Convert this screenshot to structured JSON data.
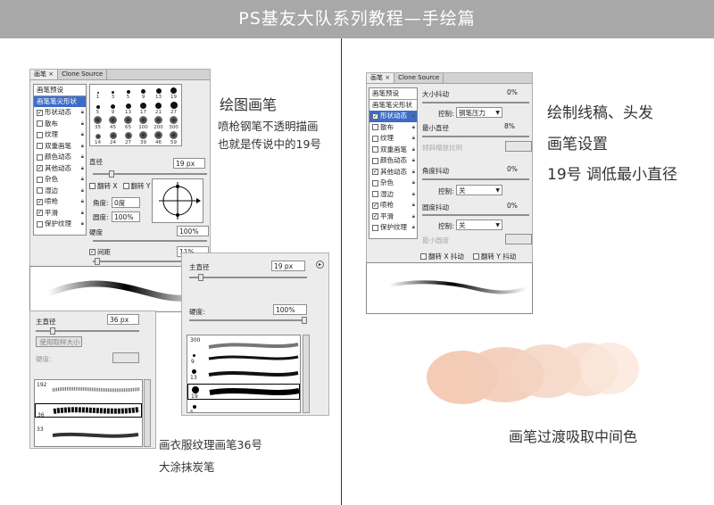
{
  "header": {
    "title": "PS基友大队系列教程—手绘篇"
  },
  "left_panel": {
    "tabs": [
      "画笔",
      "Clone Source"
    ],
    "list": [
      {
        "label": "画笔预设",
        "checked": null,
        "locked": false
      },
      {
        "label": "画笔笔尖形状",
        "checked": null,
        "locked": false,
        "selected": true
      },
      {
        "label": "形状动态",
        "checked": true,
        "locked": true
      },
      {
        "label": "散布",
        "checked": false,
        "locked": true
      },
      {
        "label": "纹理",
        "checked": false,
        "locked": true
      },
      {
        "label": "双重画笔",
        "checked": false,
        "locked": true
      },
      {
        "label": "颜色动态",
        "checked": false,
        "locked": true
      },
      {
        "label": "其他动态",
        "checked": true,
        "locked": true
      },
      {
        "label": "杂色",
        "checked": false,
        "locked": true
      },
      {
        "label": "湿边",
        "checked": false,
        "locked": true
      },
      {
        "label": "喷枪",
        "checked": true,
        "locked": true
      },
      {
        "label": "平滑",
        "checked": true,
        "locked": true
      },
      {
        "label": "保护纹理",
        "checked": false,
        "locked": true
      }
    ],
    "tips": [
      "1",
      "3",
      "5",
      "9",
      "13",
      "19",
      "5",
      "9",
      "13",
      "17",
      "21",
      "27",
      "35",
      "45",
      "65",
      "100",
      "200",
      "300",
      "14",
      "24",
      "27",
      "39",
      "46",
      "59"
    ],
    "diameter_label": "直径",
    "diameter_value": "19 px",
    "flip_x": "翻转 X",
    "flip_y": "翻转 Y",
    "angle_label": "角度:",
    "angle_value": "0度",
    "roundness_label": "圆度:",
    "roundness_value": "100%",
    "hardness_label": "硬度",
    "hardness_value": "100%",
    "spacing_label": "间距",
    "spacing_value": "11%"
  },
  "popup_a": {
    "diameter_label": "主直径",
    "diameter_value": "36 px",
    "use_sample_label": "使用取样大小",
    "hardness_label": "硬度:",
    "tips": [
      "192",
      "36",
      "33"
    ]
  },
  "popup_b": {
    "diameter_label": "主直径",
    "diameter_value": "19 px",
    "hardness_label": "硬度:",
    "hardness_value": "100%",
    "tips": [
      "300",
      "9",
      "13",
      "19",
      "5"
    ]
  },
  "right_panel": {
    "tabs": [
      "画笔",
      "Clone Source"
    ],
    "list": [
      {
        "label": "画笔预设",
        "checked": null,
        "locked": false
      },
      {
        "label": "画笔笔尖形状",
        "checked": null,
        "locked": false
      },
      {
        "label": "形状动态",
        "checked": true,
        "locked": true,
        "selected": true
      },
      {
        "label": "散布",
        "checked": false,
        "locked": true
      },
      {
        "label": "纹理",
        "checked": false,
        "locked": true
      },
      {
        "label": "双重画笔",
        "checked": false,
        "locked": true
      },
      {
        "label": "颜色动态",
        "checked": false,
        "locked": true
      },
      {
        "label": "其他动态",
        "checked": true,
        "locked": true
      },
      {
        "label": "杂色",
        "checked": false,
        "locked": true
      },
      {
        "label": "湿边",
        "checked": false,
        "locked": true
      },
      {
        "label": "喷枪",
        "checked": true,
        "locked": true
      },
      {
        "label": "平滑",
        "checked": true,
        "locked": true
      },
      {
        "label": "保护纹理",
        "checked": false,
        "locked": true
      }
    ],
    "size_jitter_label": "大小抖动",
    "size_jitter_value": "0%",
    "control_label": "控制:",
    "control_value": "钢笔压力",
    "min_diameter_label": "最小直径",
    "min_diameter_value": "8%",
    "tilt_scale_label": "倾斜缩放比例",
    "angle_jitter_label": "角度抖动",
    "angle_jitter_value": "0%",
    "control2_value": "关",
    "roundness_jitter_label": "圆度抖动",
    "roundness_jitter_value": "0%",
    "control3_value": "关",
    "min_roundness_label": "最小圆度",
    "flip_x_jitter": "翻转 X 抖动",
    "flip_y_jitter": "翻转 Y 抖动"
  },
  "annotations": {
    "draw_brush": "绘图画笔",
    "airbrush_line1": "喷枪钢笔不透明描画",
    "airbrush_line2": "也就是传说中的19号",
    "clothes_line1": "画衣服纹理画笔36号",
    "clothes_line2": "大涂抹炭笔",
    "line_title1": "绘制线稿、头发",
    "line_title2": "画笔设置",
    "line_title3": "19号  调低最小直径",
    "blend_caption": "画笔过渡吸取中间色"
  },
  "colors": {
    "header_bg": "#a8a8a8",
    "skin": "#f3c9b2",
    "selection": "#3d6cc8"
  }
}
